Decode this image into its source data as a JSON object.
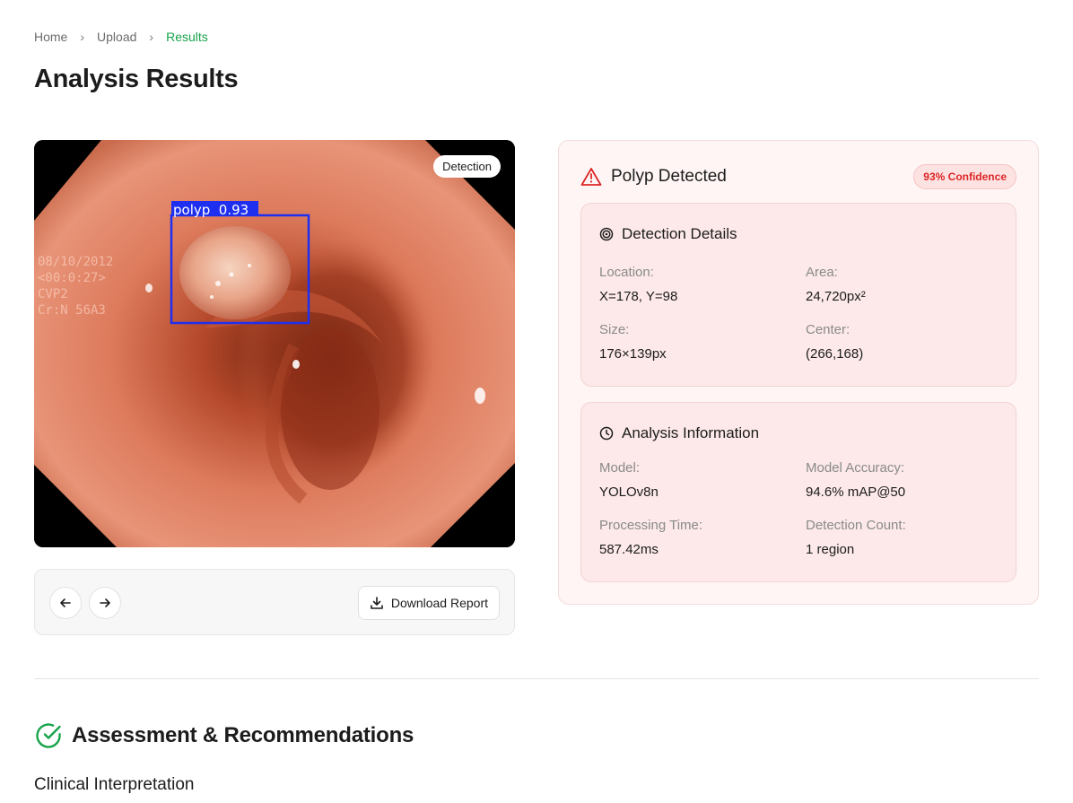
{
  "breadcrumb": {
    "items": [
      "Home",
      "Upload",
      "Results"
    ]
  },
  "page_title": "Analysis Results",
  "image": {
    "tag": "Detection",
    "box_label": "polyp  0.93",
    "overlay_text": [
      "08/10/2012",
      "<00:0:27>",
      "CVP2",
      "Cr:N 56A3"
    ]
  },
  "controls": {
    "download_label": "Download Report"
  },
  "result": {
    "title": "Polyp Detected",
    "confidence": "93% Confidence",
    "detection": {
      "title": "Detection Details",
      "location_label": "Location:",
      "location_value": "X=178, Y=98",
      "area_label": "Area:",
      "area_value": "24,720px²",
      "size_label": "Size:",
      "size_value": "176×139px",
      "center_label": "Center:",
      "center_value": "(266,168)"
    },
    "analysis": {
      "title": "Analysis Information",
      "model_label": "Model:",
      "model_value": "YOLOv8n",
      "accuracy_label": "Model Accuracy:",
      "accuracy_value": "94.6% mAP@50",
      "time_label": "Processing Time:",
      "time_value": "587.42ms",
      "count_label": "Detection Count:",
      "count_value": "1 region"
    }
  },
  "assessment": {
    "title": "Assessment & Recommendations",
    "subtitle": "Clinical Interpretation"
  },
  "colors": {
    "accent_green": "#17a34a",
    "alert_red": "#dc2626",
    "box_blue": "#1e2ff0"
  }
}
